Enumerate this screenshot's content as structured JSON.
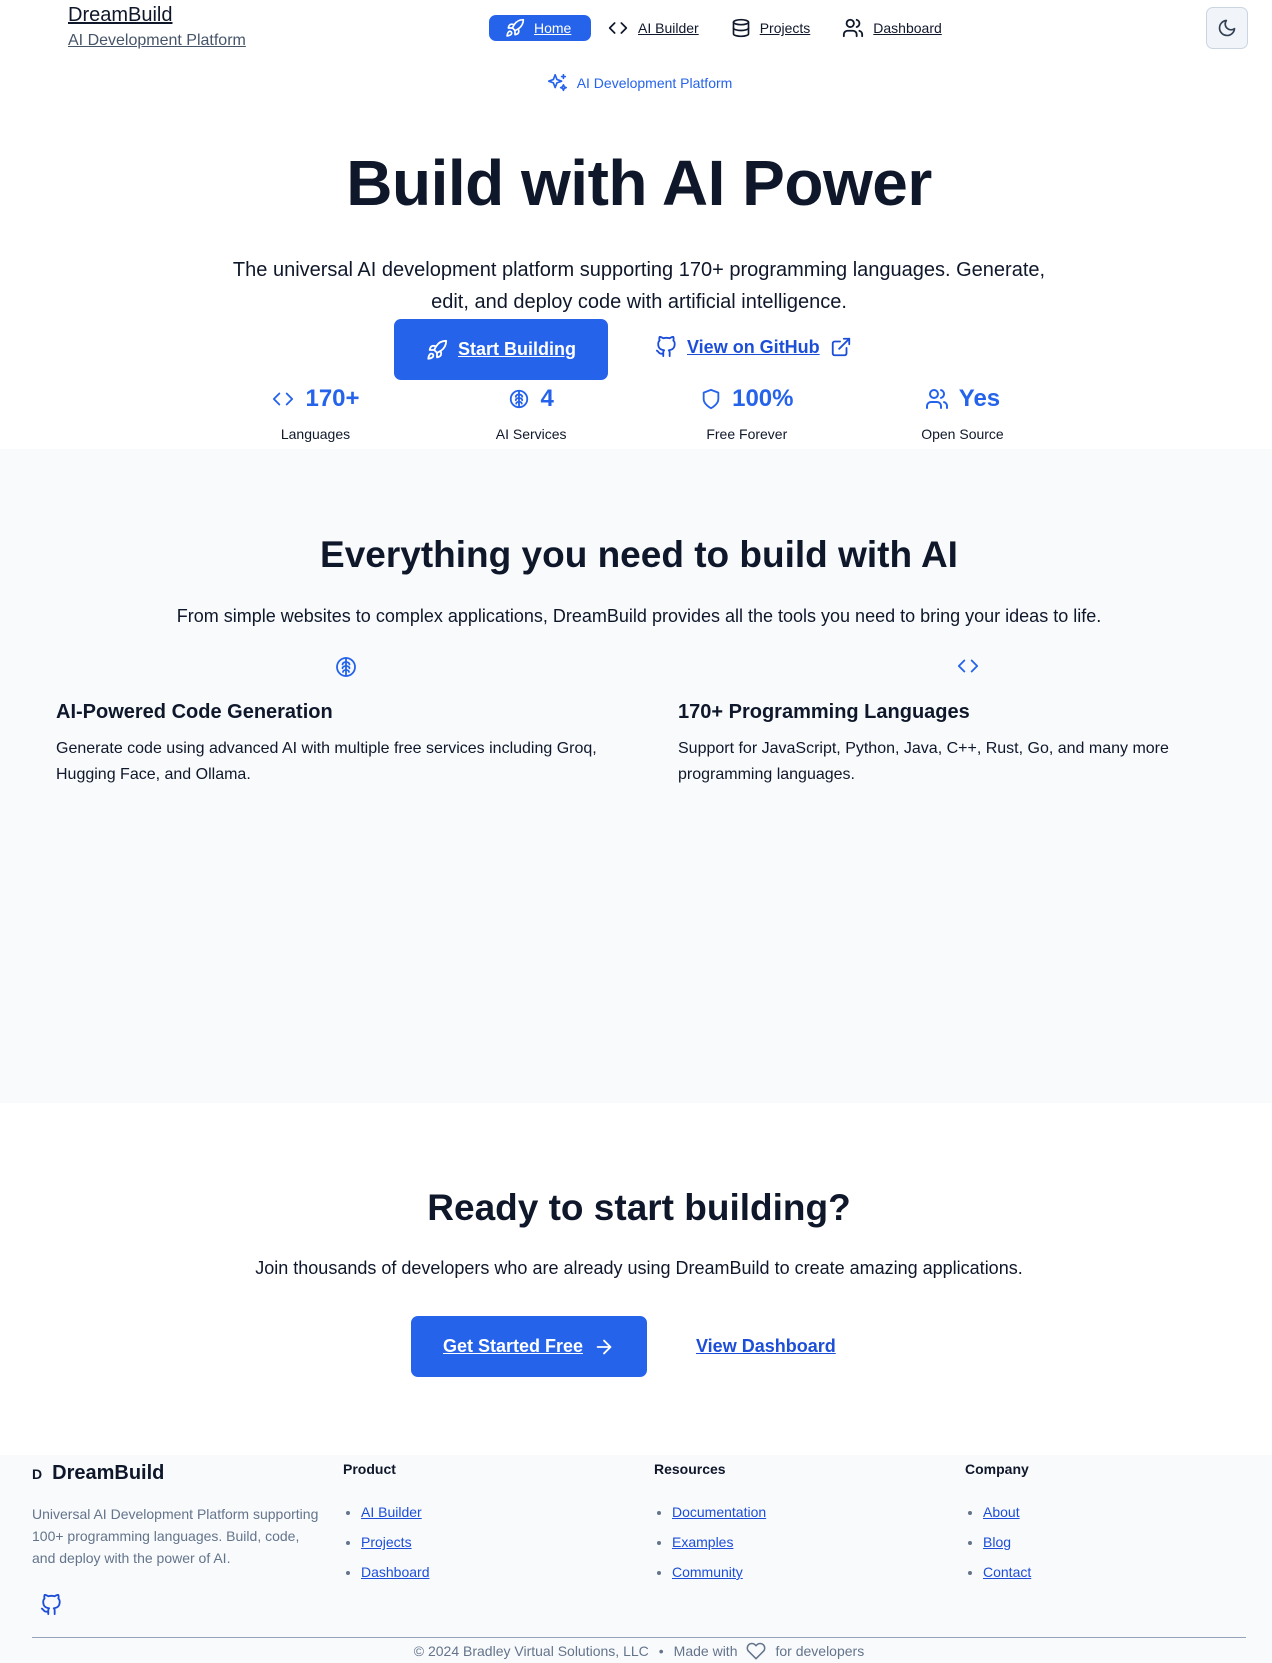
{
  "header": {
    "brand_name": "DreamBuild",
    "brand_subtitle": "AI Development Platform",
    "nav": [
      {
        "label": "Home",
        "icon": "rocket-icon",
        "active": true
      },
      {
        "label": "AI Builder",
        "icon": "code-icon",
        "active": false
      },
      {
        "label": "Projects",
        "icon": "database-icon",
        "active": false
      },
      {
        "label": "Dashboard",
        "icon": "users-icon",
        "active": false
      }
    ],
    "theme_toggle_icon": "moon-icon"
  },
  "hero": {
    "badge": "AI Development Platform",
    "title": "Build with AI Power",
    "subtitle": "The universal AI development platform supporting 170+ programming languages. Generate, edit, and deploy code with artificial intelligence.",
    "primary_cta": "Start Building",
    "secondary_cta": "View on GitHub",
    "stats": [
      {
        "value": "170+",
        "label": "Languages",
        "icon": "code-icon"
      },
      {
        "value": "4",
        "label": "AI Services",
        "icon": "brain-icon"
      },
      {
        "value": "100%",
        "label": "Free Forever",
        "icon": "shield-icon"
      },
      {
        "value": "Yes",
        "label": "Open Source",
        "icon": "users-icon"
      }
    ]
  },
  "features": {
    "title": "Everything you need to build with AI",
    "subtitle": "From simple websites to complex applications, DreamBuild provides all the tools you need to bring your ideas to life.",
    "items": [
      {
        "title": "AI-Powered Code Generation",
        "description": "Generate code using advanced AI with multiple free services including Groq, Hugging Face, and Ollama.",
        "icon": "brain-icon"
      },
      {
        "title": "170+ Programming Languages",
        "description": "Support for JavaScript, Python, Java, C++, Rust, Go, and many more programming languages.",
        "icon": "code-icon"
      }
    ]
  },
  "cta": {
    "title": "Ready to start building?",
    "subtitle": "Join thousands of developers who are already using DreamBuild to create amazing applications.",
    "primary": "Get Started Free",
    "secondary": "View Dashboard"
  },
  "footer": {
    "logo_letter": "D",
    "brand": "DreamBuild",
    "description": "Universal AI Development Platform supporting 100+ programming languages. Build, code, and deploy with the power of AI.",
    "columns": [
      {
        "title": "Product",
        "links": [
          "AI Builder",
          "Projects",
          "Dashboard"
        ]
      },
      {
        "title": "Resources",
        "links": [
          "Documentation",
          "Examples",
          "Community"
        ]
      },
      {
        "title": "Company",
        "links": [
          "About",
          "Blog",
          "Contact"
        ]
      }
    ],
    "copyright": "© 2024 Bradley Virtual Solutions, LLC",
    "separator": "•",
    "made_with": "Made with",
    "for_developers": "for developers"
  },
  "colors": {
    "accent": "#2563eb",
    "link": "#1d4ed8",
    "text": "#0f172a",
    "muted": "#64748b",
    "section_bg": "#f8fafc"
  }
}
